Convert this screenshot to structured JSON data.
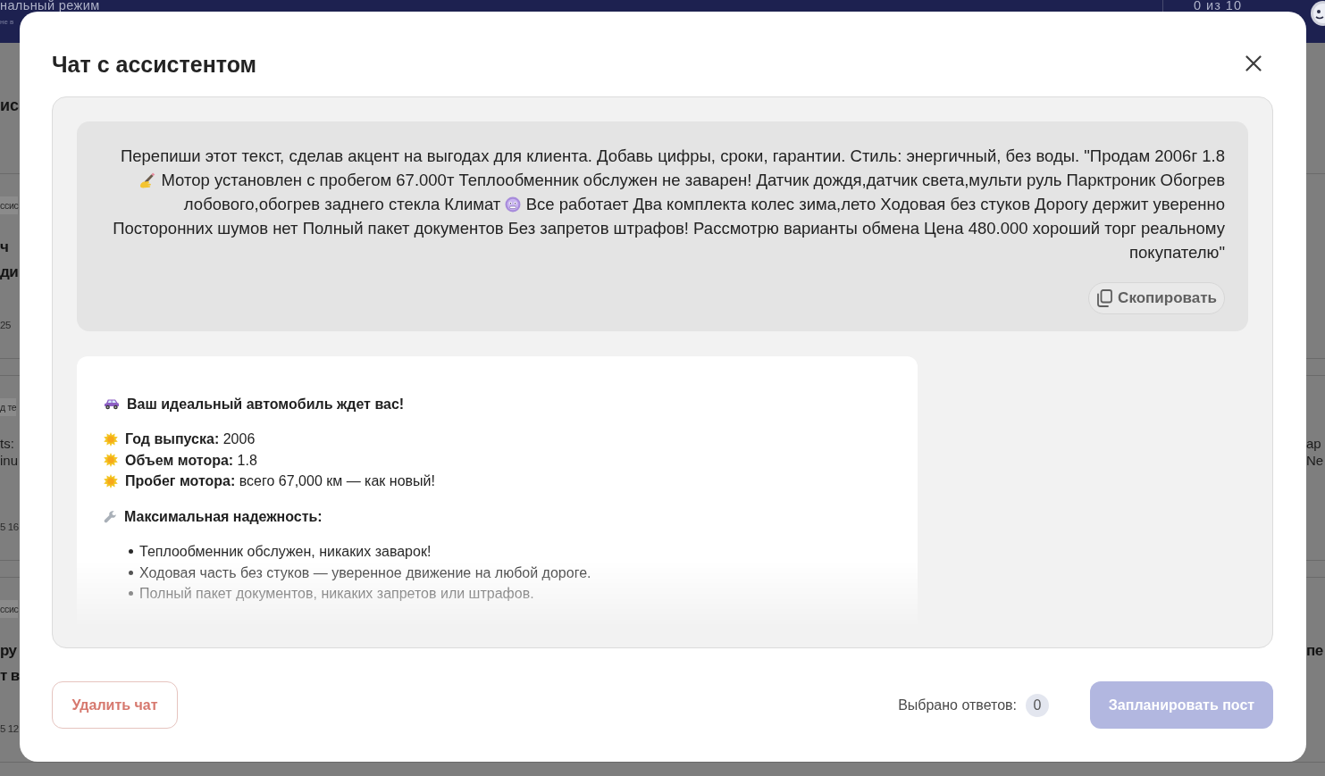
{
  "background_page": {
    "header": {
      "title": "нальный режим",
      "subtitle": "не в",
      "counter": "0 из 10"
    },
    "heading": "ис",
    "cards": [
      {
        "left": {
          "chip": "ссис",
          "title_lines": [
            "ч",
            "ди"
          ],
          "meta": "25"
        }
      },
      {
        "left": {
          "chip": "д те",
          "text_lines": [
            "ts:",
            "inu"
          ],
          "meta": "5 16"
        },
        "right": {
          "text_lines": [
            "ap",
            "Ne"
          ]
        }
      },
      {
        "left": {
          "chip": "ссис",
          "title_lines": [
            "ру",
            "т в"
          ],
          "meta": "5 12"
        },
        "right": {
          "title_lines": [
            "пе"
          ]
        }
      }
    ]
  },
  "dialog": {
    "title": "Чат с ассистентом",
    "messages": [
      {
        "kind": "user",
        "parts": [
          {
            "kind": "text",
            "text": "Перепиши этот текст, сделав акцент на выгодах для клиента. Добавь цифры, сроки, гарантии. Стиль: энергичный, без воды. \"Продам 2006г 1.8"
          },
          {
            "kind": "hand"
          },
          {
            "kind": "text",
            "text": "Мотор установлен с пробегом 67.000т Теплообменник обслужен не заварен! Датчик дождя,датчик света,мульти руль Парктроник Обогрев лобового,обогрев заднего стекла Климат"
          },
          {
            "kind": "face"
          },
          {
            "kind": "text",
            "text": "Все работает Два комплекта колес зима,лето Ходовая без стуков Дорогу держит уверенно Посторонних шумов нет Полный пакет документов Без запретов штрафов! Рассмотрю варианты обмена Цена 480.000 хороший торг реальному покупателю\""
          }
        ],
        "copy_button": "Скопировать"
      },
      {
        "kind": "assistant",
        "blocks": [
          {
            "kind": "title",
            "text": "Ваш идеальный автомобиль ждет вас!"
          },
          {
            "kind": "fact",
            "text": "**Год выпуска:** 2006"
          },
          {
            "kind": "fact",
            "text": "**Объем мотора:** 1.8"
          },
          {
            "kind": "fact",
            "text": "**Пробег мотора:** всего 67,000 км — как новый!"
          },
          {
            "kind": "section",
            "text": "Максимальная надежность:"
          },
          {
            "kind": "bullet",
            "text": "Теплообменник обслужен, никаких заварок!"
          },
          {
            "kind": "bullet",
            "text": "Ходовая часть без стуков — уверенное движение на любой дороге."
          },
          {
            "kind": "bullet",
            "text": "Полный пакет документов, никаких запретов или штрафов."
          }
        ]
      }
    ]
  },
  "footer": {
    "delete_button": "Удалить чат",
    "selected_label": "Выбрано ответов:",
    "selected_count": "0",
    "schedule_button": {
      "label": "Запланировать пост",
      "disabled": true
    }
  }
}
